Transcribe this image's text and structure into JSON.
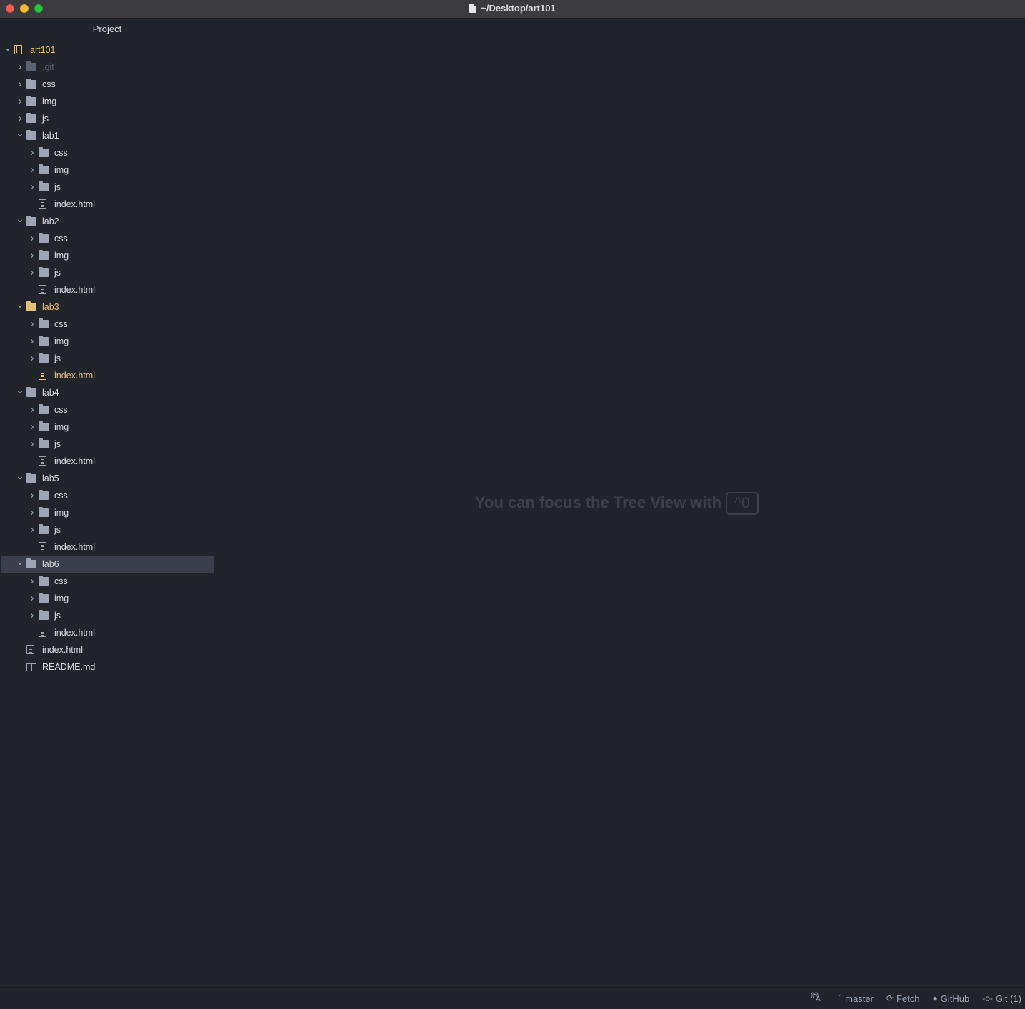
{
  "window": {
    "title": "~/Desktop/art101",
    "controls": [
      "close",
      "minimize",
      "maximize"
    ]
  },
  "tree": {
    "header": "Project",
    "items": [
      {
        "label": "art101",
        "type": "root",
        "depth": 0,
        "expanded": true,
        "state": "modified"
      },
      {
        "label": ".git",
        "type": "folder",
        "depth": 1,
        "expanded": false,
        "state": "ignored"
      },
      {
        "label": "css",
        "type": "folder",
        "depth": 1,
        "expanded": false,
        "state": "normal"
      },
      {
        "label": "img",
        "type": "folder",
        "depth": 1,
        "expanded": false,
        "state": "normal"
      },
      {
        "label": "js",
        "type": "folder",
        "depth": 1,
        "expanded": false,
        "state": "normal"
      },
      {
        "label": "lab1",
        "type": "folder",
        "depth": 1,
        "expanded": true,
        "state": "normal"
      },
      {
        "label": "css",
        "type": "folder",
        "depth": 2,
        "expanded": false,
        "state": "normal"
      },
      {
        "label": "img",
        "type": "folder",
        "depth": 2,
        "expanded": false,
        "state": "normal"
      },
      {
        "label": "js",
        "type": "folder",
        "depth": 2,
        "expanded": false,
        "state": "normal"
      },
      {
        "label": "index.html",
        "type": "file",
        "depth": 2,
        "state": "normal"
      },
      {
        "label": "lab2",
        "type": "folder",
        "depth": 1,
        "expanded": true,
        "state": "normal"
      },
      {
        "label": "css",
        "type": "folder",
        "depth": 2,
        "expanded": false,
        "state": "normal"
      },
      {
        "label": "img",
        "type": "folder",
        "depth": 2,
        "expanded": false,
        "state": "normal"
      },
      {
        "label": "js",
        "type": "folder",
        "depth": 2,
        "expanded": false,
        "state": "normal"
      },
      {
        "label": "index.html",
        "type": "file",
        "depth": 2,
        "state": "normal"
      },
      {
        "label": "lab3",
        "type": "folder",
        "depth": 1,
        "expanded": true,
        "state": "modified"
      },
      {
        "label": "css",
        "type": "folder",
        "depth": 2,
        "expanded": false,
        "state": "normal"
      },
      {
        "label": "img",
        "type": "folder",
        "depth": 2,
        "expanded": false,
        "state": "normal"
      },
      {
        "label": "js",
        "type": "folder",
        "depth": 2,
        "expanded": false,
        "state": "normal"
      },
      {
        "label": "index.html",
        "type": "file",
        "depth": 2,
        "state": "modified"
      },
      {
        "label": "lab4",
        "type": "folder",
        "depth": 1,
        "expanded": true,
        "state": "normal"
      },
      {
        "label": "css",
        "type": "folder",
        "depth": 2,
        "expanded": false,
        "state": "normal"
      },
      {
        "label": "img",
        "type": "folder",
        "depth": 2,
        "expanded": false,
        "state": "normal"
      },
      {
        "label": "js",
        "type": "folder",
        "depth": 2,
        "expanded": false,
        "state": "normal"
      },
      {
        "label": "index.html",
        "type": "file",
        "depth": 2,
        "state": "normal"
      },
      {
        "label": "lab5",
        "type": "folder",
        "depth": 1,
        "expanded": true,
        "state": "normal"
      },
      {
        "label": "css",
        "type": "folder",
        "depth": 2,
        "expanded": false,
        "state": "normal"
      },
      {
        "label": "img",
        "type": "folder",
        "depth": 2,
        "expanded": false,
        "state": "normal"
      },
      {
        "label": "js",
        "type": "folder",
        "depth": 2,
        "expanded": false,
        "state": "normal"
      },
      {
        "label": "index.html",
        "type": "file",
        "depth": 2,
        "state": "normal"
      },
      {
        "label": "lab6",
        "type": "folder",
        "depth": 1,
        "expanded": true,
        "state": "normal",
        "selected": true
      },
      {
        "label": "css",
        "type": "folder",
        "depth": 2,
        "expanded": false,
        "state": "normal"
      },
      {
        "label": "img",
        "type": "folder",
        "depth": 2,
        "expanded": false,
        "state": "normal"
      },
      {
        "label": "js",
        "type": "folder",
        "depth": 2,
        "expanded": false,
        "state": "normal"
      },
      {
        "label": "index.html",
        "type": "file",
        "depth": 2,
        "state": "normal"
      },
      {
        "label": "index.html",
        "type": "file",
        "depth": 1,
        "state": "normal"
      },
      {
        "label": "README.md",
        "type": "markdown",
        "depth": 1,
        "state": "normal"
      }
    ]
  },
  "editor": {
    "hint_text": "You can focus the Tree View with",
    "hint_shortcut": "^0"
  },
  "statusbar": {
    "teletype_icon": "broadcast-icon",
    "branch": "master",
    "fetch": "Fetch",
    "github": "GitHub",
    "git": "Git (1)"
  },
  "colors": {
    "background": "#21252b",
    "selected_row": "#3a3f4b",
    "modified": "#e5c07b",
    "ignored": "#5c6370",
    "text": "#d7dae0"
  }
}
